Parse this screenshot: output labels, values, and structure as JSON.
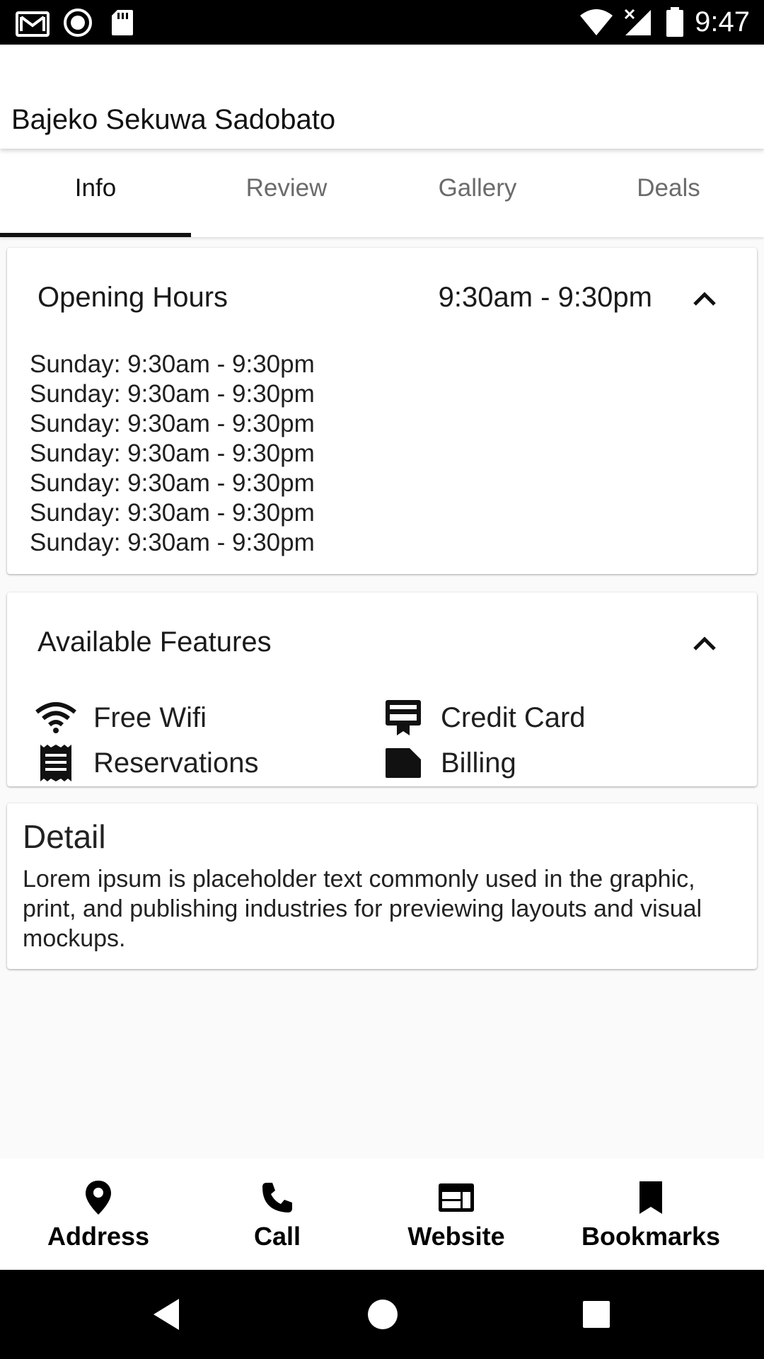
{
  "status_bar": {
    "time": "9:47",
    "left_icons": [
      "gmail-icon",
      "record-icon",
      "sd-card-icon"
    ],
    "right_icons": [
      "wifi-icon",
      "signal-icon",
      "battery-icon"
    ]
  },
  "app_bar": {
    "title": "Bajeko Sekuwa Sadobato"
  },
  "tabs": [
    {
      "label": "Info",
      "active": true
    },
    {
      "label": "Review",
      "active": false
    },
    {
      "label": "Gallery",
      "active": false
    },
    {
      "label": "Deals",
      "active": false
    }
  ],
  "opening_hours": {
    "title": "Opening Hours",
    "summary": "9:30am - 9:30pm",
    "expanded": true,
    "rows": [
      "Sunday: 9:30am - 9:30pm",
      "Sunday: 9:30am - 9:30pm",
      "Sunday: 9:30am - 9:30pm",
      "Sunday: 9:30am - 9:30pm",
      "Sunday: 9:30am - 9:30pm",
      "Sunday: 9:30am - 9:30pm",
      "Sunday: 9:30am - 9:30pm"
    ]
  },
  "features": {
    "title": "Available Features",
    "expanded": true,
    "items": [
      {
        "label": "Free Wifi",
        "icon": "wifi-icon"
      },
      {
        "label": "Credit Card",
        "icon": "credit-card-icon"
      },
      {
        "label": "Reservations",
        "icon": "receipt-icon"
      },
      {
        "label": "Billing",
        "icon": "billing-icon"
      }
    ]
  },
  "detail": {
    "title": "Detail",
    "body": "Lorem ipsum is placeholder text commonly used in the graphic, print, and publishing industries for previewing layouts and visual mockups."
  },
  "bottom_actions": [
    {
      "label": "Address",
      "icon": "location-pin-icon"
    },
    {
      "label": "Call",
      "icon": "phone-icon"
    },
    {
      "label": "Website",
      "icon": "web-icon"
    },
    {
      "label": "Bookmarks",
      "icon": "bookmark-icon"
    }
  ],
  "nav_bar": {
    "buttons": [
      "back-icon",
      "home-icon",
      "recents-icon"
    ]
  }
}
